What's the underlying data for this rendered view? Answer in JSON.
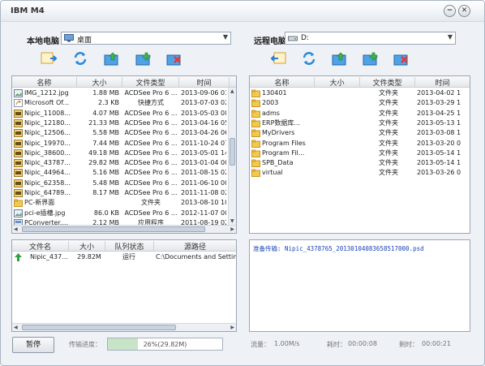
{
  "window": {
    "title": "IBM M4",
    "minimize": "−",
    "close": "✕"
  },
  "local": {
    "label": "本地电脑",
    "path": "桌面",
    "toolbar": [
      "upload-icon",
      "refresh-icon",
      "up-folder-icon",
      "new-folder-icon",
      "delete-icon"
    ],
    "columns": [
      "名称",
      "大小",
      "文件类型",
      "时间"
    ],
    "rows": [
      {
        "icon": "image-file-icon",
        "name": "IMG_1212.jpg",
        "size": "1.88 MB",
        "type": "ACDSee Pro 6 ...",
        "time": "2013-09-06 03."
      },
      {
        "icon": "shortcut-icon",
        "name": "Microsoft Of...",
        "size": "2.3 KB",
        "type": "快捷方式",
        "time": "2013-07-03 02."
      },
      {
        "icon": "psd-file-icon",
        "name": "Nipic_11008...",
        "size": "4.07 MB",
        "type": "ACDSee Pro 6 ...",
        "time": "2013-05-03 08."
      },
      {
        "icon": "psd-file-icon",
        "name": "Nipic_12180...",
        "size": "21.33 MB",
        "type": "ACDSee Pro 6 ...",
        "time": "2013-04-16 05."
      },
      {
        "icon": "psd-file-icon",
        "name": "Nipic_12506...",
        "size": "5.58 MB",
        "type": "ACDSee Pro 6 ...",
        "time": "2013-04-26 06."
      },
      {
        "icon": "psd-file-icon",
        "name": "Nipic_19970...",
        "size": "7.44 MB",
        "type": "ACDSee Pro 6 ...",
        "time": "2011-10-24 07."
      },
      {
        "icon": "psd-file-icon",
        "name": "Nipic_38600...",
        "size": "49.18 MB",
        "type": "ACDSee Pro 6 ...",
        "time": "2013-05-01 14."
      },
      {
        "icon": "psd-file-icon",
        "name": "Nipic_43787...",
        "size": "29.82 MB",
        "type": "ACDSee Pro 6 ...",
        "time": "2013-01-04 00."
      },
      {
        "icon": "psd-file-icon",
        "name": "Nipic_44964...",
        "size": "5.16 MB",
        "type": "ACDSee Pro 6 ...",
        "time": "2011-08-15 02."
      },
      {
        "icon": "psd-file-icon",
        "name": "Nipic_62358...",
        "size": "5.48 MB",
        "type": "ACDSee Pro 6 ...",
        "time": "2011-06-10 00."
      },
      {
        "icon": "psd-file-icon",
        "name": "Nipic_64789...",
        "size": "8.17 MB",
        "type": "ACDSee Pro 6 ...",
        "time": "2011-11-08 02."
      },
      {
        "icon": "folder-icon",
        "name": "PC-新界面",
        "size": "",
        "type": "文件夹",
        "time": "2013-08-10 10."
      },
      {
        "icon": "image-file-icon",
        "name": "pci-e插槽.jpg",
        "size": "86.0 KB",
        "type": "ACDSee Pro 6 ...",
        "time": "2012-11-07 00."
      },
      {
        "icon": "exe-file-icon",
        "name": "PConverter....",
        "size": "2.12 MB",
        "type": "应用程序",
        "time": "2011-08-19 02."
      }
    ]
  },
  "remote": {
    "label": "远程电脑",
    "path": "D:",
    "toolbar": [
      "download-icon",
      "refresh-icon",
      "up-folder-icon",
      "new-folder-icon",
      "delete-icon"
    ],
    "columns": [
      "名称",
      "大小",
      "文件类型",
      "时间"
    ],
    "rows": [
      {
        "name": "130401",
        "size": "",
        "type": "文件夹",
        "time": "2013-04-02 1"
      },
      {
        "name": "2003",
        "size": "",
        "type": "文件夹",
        "time": "2013-03-29 1"
      },
      {
        "name": "adms",
        "size": "",
        "type": "文件夹",
        "time": "2013-04-25 1"
      },
      {
        "name": "ERP数据库...",
        "size": "",
        "type": "文件夹",
        "time": "2013-05-13 1"
      },
      {
        "name": "MyDrivers",
        "size": "",
        "type": "文件夹",
        "time": "2013-03-08 1"
      },
      {
        "name": "Program Files",
        "size": "",
        "type": "文件夹",
        "time": "2013-03-20 0"
      },
      {
        "name": "Program Fil...",
        "size": "",
        "type": "文件夹",
        "time": "2013-05-14 1"
      },
      {
        "name": "SPB_Data",
        "size": "",
        "type": "文件夹",
        "time": "2013-05-14 1"
      },
      {
        "name": "virtual",
        "size": "",
        "type": "文件夹",
        "time": "2013-03-26 0"
      }
    ]
  },
  "queue": {
    "columns": [
      "文件名",
      "大小",
      "队列状态",
      "源路径"
    ],
    "rows": [
      {
        "name": "Nipic_437...",
        "size": "29.82M",
        "status": "运行",
        "path": "C:\\Documents and Settings\\s"
      }
    ]
  },
  "log": {
    "text": "准备传输: Nipic_4378765_20130104083658517000.psd"
  },
  "status": {
    "pause_label": "暂停",
    "progress_label": "传输进度：",
    "progress_text": "26%(29.82M)",
    "progress_fraction": 0.26,
    "speed_label": "流量：",
    "speed": "1.00M/s",
    "elapsed_label": "耗时：",
    "elapsed": "00:00:08",
    "remaining_label": "剩时：",
    "remaining": "00:00:21"
  },
  "colors": {
    "folder": "#f3c94c",
    "accent": "#1a44b8",
    "progress_fill": "#c8e4c6"
  }
}
